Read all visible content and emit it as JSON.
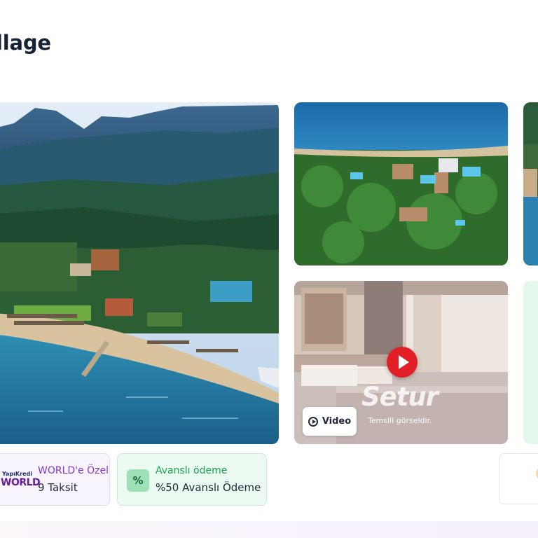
{
  "page": {
    "title": "llage"
  },
  "gallery": {
    "main_image": {
      "alt": "Aerial view of resort beach, pier and mountains"
    },
    "second_image": {
      "alt": "Aerial view of resort grounds and pools"
    },
    "video_tile": {
      "watermark": "Setur",
      "disclaimer": "Temsili görseldir.",
      "video_button_label": "Video"
    }
  },
  "promos": [
    {
      "logo_top": "YapıKredi",
      "logo_main": "WORLD",
      "title": "WORLD'e Özel",
      "subtitle": "9 Taksit"
    },
    {
      "icon_symbol": "%",
      "title": "Avanslı ödeme",
      "subtitle": "%50 Avanslı Ödeme"
    }
  ],
  "colors": {
    "title": "#152337",
    "play_red": "#e21e26",
    "world_purple": "#8b34c6",
    "avans_green": "#16a34a"
  }
}
